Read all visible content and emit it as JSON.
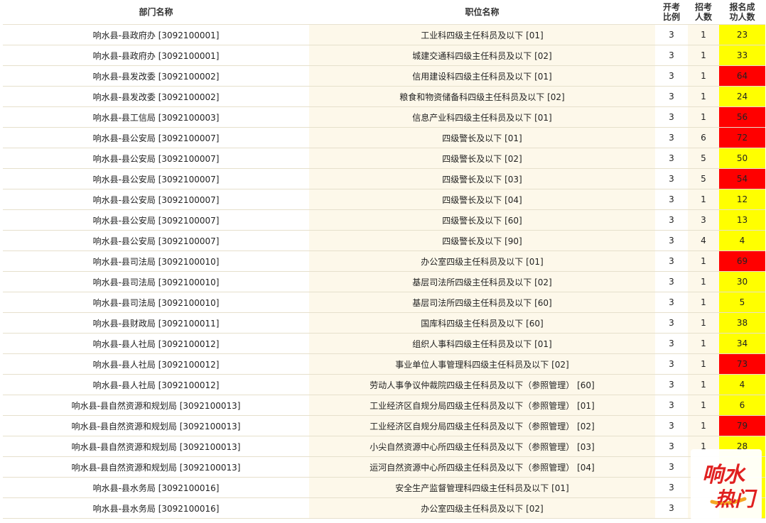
{
  "headers": {
    "dept": "部门名称",
    "position": "职位名称",
    "ratio_line1": "开考",
    "ratio_line2": "比例",
    "quota_line1": "招考",
    "quota_line2": "人数",
    "applicants_line1": "报名成",
    "applicants_line2": "功人数"
  },
  "colors": {
    "low": "#ffff00",
    "high": "#ff0000",
    "stripe": "#fdf8ea"
  },
  "rows": [
    {
      "dept": "响水县-县政府办 [3092100001]",
      "position": "工业科四级主任科员及以下 [01]",
      "ratio": "3",
      "quota": "1",
      "applicants": "23",
      "level": "yellow"
    },
    {
      "dept": "响水县-县政府办 [3092100001]",
      "position": "城建交通科四级主任科员及以下 [02]",
      "ratio": "3",
      "quota": "1",
      "applicants": "33",
      "level": "yellow"
    },
    {
      "dept": "响水县-县发改委 [3092100002]",
      "position": "信用建设科四级主任科员及以下 [01]",
      "ratio": "3",
      "quota": "1",
      "applicants": "64",
      "level": "red"
    },
    {
      "dept": "响水县-县发改委 [3092100002]",
      "position": "粮食和物资储备科四级主任科员及以下 [02]",
      "ratio": "3",
      "quota": "1",
      "applicants": "24",
      "level": "yellow"
    },
    {
      "dept": "响水县-县工信局 [3092100003]",
      "position": "信息产业科四级主任科员及以下 [01]",
      "ratio": "3",
      "quota": "1",
      "applicants": "56",
      "level": "red"
    },
    {
      "dept": "响水县-县公安局 [3092100007]",
      "position": "四级警长及以下 [01]",
      "ratio": "3",
      "quota": "6",
      "applicants": "72",
      "level": "red"
    },
    {
      "dept": "响水县-县公安局 [3092100007]",
      "position": "四级警长及以下 [02]",
      "ratio": "3",
      "quota": "5",
      "applicants": "50",
      "level": "yellow"
    },
    {
      "dept": "响水县-县公安局 [3092100007]",
      "position": "四级警长及以下 [03]",
      "ratio": "3",
      "quota": "5",
      "applicants": "54",
      "level": "red"
    },
    {
      "dept": "响水县-县公安局 [3092100007]",
      "position": "四级警长及以下 [04]",
      "ratio": "3",
      "quota": "1",
      "applicants": "12",
      "level": "yellow"
    },
    {
      "dept": "响水县-县公安局 [3092100007]",
      "position": "四级警长及以下 [60]",
      "ratio": "3",
      "quota": "3",
      "applicants": "13",
      "level": "yellow"
    },
    {
      "dept": "响水县-县公安局 [3092100007]",
      "position": "四级警长及以下 [90]",
      "ratio": "3",
      "quota": "4",
      "applicants": "4",
      "level": "yellow"
    },
    {
      "dept": "响水县-县司法局 [3092100010]",
      "position": "办公室四级主任科员及以下 [01]",
      "ratio": "3",
      "quota": "1",
      "applicants": "69",
      "level": "red"
    },
    {
      "dept": "响水县-县司法局 [3092100010]",
      "position": "基层司法所四级主任科员及以下 [02]",
      "ratio": "3",
      "quota": "1",
      "applicants": "30",
      "level": "yellow"
    },
    {
      "dept": "响水县-县司法局 [3092100010]",
      "position": "基层司法所四级主任科员及以下 [60]",
      "ratio": "3",
      "quota": "1",
      "applicants": "5",
      "level": "yellow"
    },
    {
      "dept": "响水县-县财政局 [3092100011]",
      "position": "国库科四级主任科员及以下 [60]",
      "ratio": "3",
      "quota": "1",
      "applicants": "38",
      "level": "yellow"
    },
    {
      "dept": "响水县-县人社局 [3092100012]",
      "position": "组织人事科四级主任科员及以下 [01]",
      "ratio": "3",
      "quota": "1",
      "applicants": "34",
      "level": "yellow"
    },
    {
      "dept": "响水县-县人社局 [3092100012]",
      "position": "事业单位人事管理科四级主任科员及以下 [02]",
      "ratio": "3",
      "quota": "1",
      "applicants": "73",
      "level": "red"
    },
    {
      "dept": "响水县-县人社局 [3092100012]",
      "position": "劳动人事争议仲裁院四级主任科员及以下（参照管理） [60]",
      "ratio": "3",
      "quota": "1",
      "applicants": "4",
      "level": "yellow"
    },
    {
      "dept": "响水县-县自然资源和规划局 [3092100013]",
      "position": "工业经济区自规分局四级主任科员及以下（参照管理） [01]",
      "ratio": "3",
      "quota": "1",
      "applicants": "6",
      "level": "yellow"
    },
    {
      "dept": "响水县-县自然资源和规划局 [3092100013]",
      "position": "工业经济区自规分局四级主任科员及以下（参照管理） [02]",
      "ratio": "3",
      "quota": "1",
      "applicants": "79",
      "level": "red"
    },
    {
      "dept": "响水县-县自然资源和规划局 [3092100013]",
      "position": "小尖自然资源中心所四级主任科员及以下（参照管理） [03]",
      "ratio": "3",
      "quota": "1",
      "applicants": "28",
      "level": "yellow"
    },
    {
      "dept": "响水县-县自然资源和规划局 [3092100013]",
      "position": "运河自然资源中心所四级主任科员及以下（参照管理） [04]",
      "ratio": "3",
      "quota": "",
      "applicants": "",
      "level": "yellow"
    },
    {
      "dept": "响水县-县水务局 [3092100016]",
      "position": "安全生产监督管理科四级主任科员及以下 [01]",
      "ratio": "3",
      "quota": "",
      "applicants": "",
      "level": "yellow"
    },
    {
      "dept": "响水县-县水务局 [3092100016]",
      "position": "办公室四级主任科员及以下 [02]",
      "ratio": "3",
      "quota": "",
      "applicants": "",
      "level": "yellow"
    }
  ],
  "watermark": {
    "text_line1": "响水",
    "text_line2": "热门"
  }
}
